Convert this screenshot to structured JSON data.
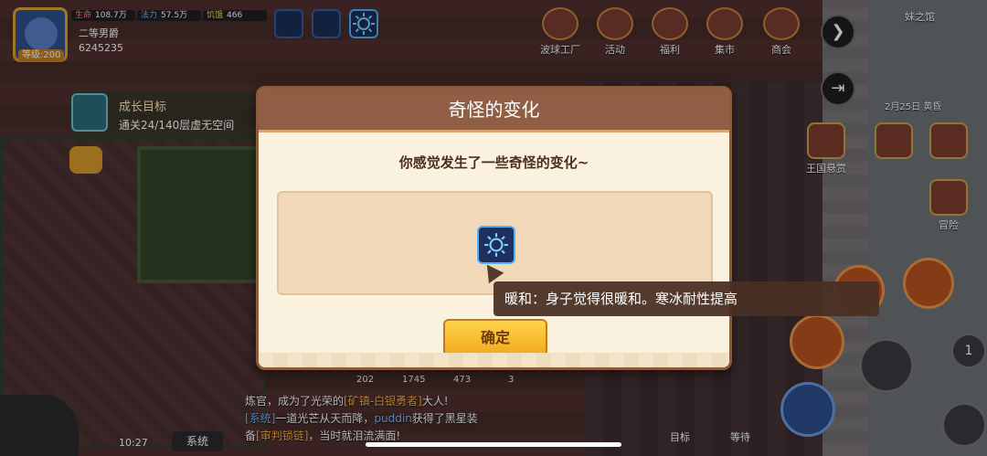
{
  "hud": {
    "level": "等级:200",
    "hp_label": "生命",
    "hp_value": "108.7万",
    "mp_label": "法力",
    "mp_value": "57.5万",
    "hunger_label": "饥饿",
    "hunger_value": "466",
    "rank": "二等男爵",
    "gold": "6245235"
  },
  "goal": {
    "title": "成长目标",
    "desc": "通关24/140层虚无空间"
  },
  "top_menu": [
    {
      "label": "波球工厂",
      "icon": "factory-icon"
    },
    {
      "label": "活动",
      "icon": "event-icon"
    },
    {
      "label": "福利",
      "icon": "gift-icon"
    },
    {
      "label": "集市",
      "icon": "market-icon"
    },
    {
      "label": "商会",
      "icon": "guild-icon"
    }
  ],
  "map": {
    "location": "妹之馆",
    "date": "2月25日 黄昏"
  },
  "side_buttons": {
    "bounty": "王国悬赏",
    "adventure": "冒险"
  },
  "chat": {
    "line1_prefix": "炼官，成为了光荣的",
    "line1_title": "[矿镇-白银勇者]",
    "line1_suffix": "大人!",
    "line2_tag": "[系统]",
    "line2_text": "一道光芒从天而降，",
    "line2_player": "puddin",
    "line2_suffix": "获得了黑星装",
    "line3_prefix": "备",
    "line3_item": "[审判锁链]",
    "line3_suffix": "，当时就泪流满面!"
  },
  "bottom": {
    "time": "10:27",
    "channel": "系统",
    "nums": [
      "202",
      "1745",
      "473",
      "3"
    ],
    "nav_goal": "目标",
    "nav_wait": "等待",
    "counter": "1"
  },
  "dialog": {
    "title": "奇怪的变化",
    "message": "你感觉发生了一些奇怪的变化~",
    "confirm_label": "确定",
    "reward_icon": "sun-icon"
  },
  "tooltip": {
    "text": "暖和：身子觉得很暖和。寒冰耐性提高"
  },
  "colors": {
    "dialog_header": "#8f5e44",
    "dialog_bg": "#fbf1df",
    "confirm_button": "#f2a81c",
    "buff_border": "#4fb1ff"
  }
}
